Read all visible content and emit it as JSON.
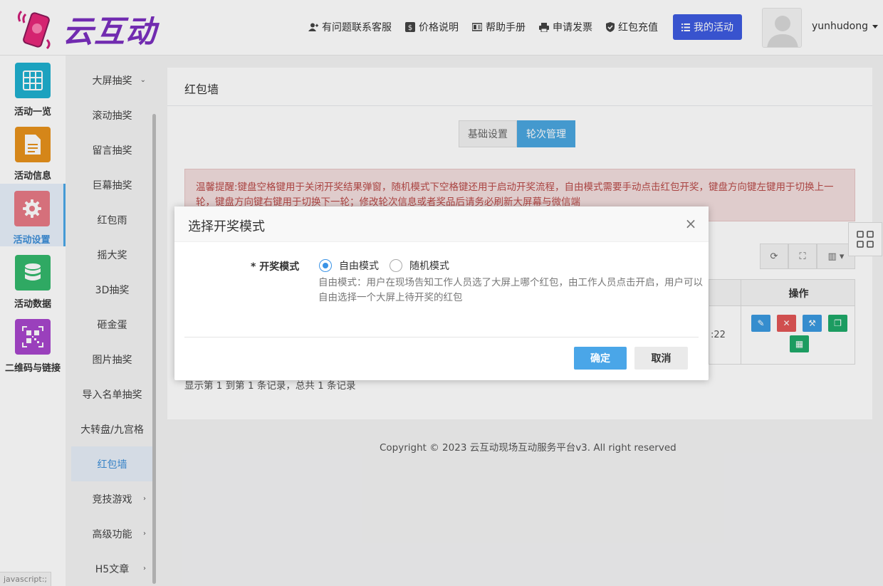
{
  "header": {
    "logo_text": "云互动",
    "nav": [
      {
        "label": "有问题联系客服",
        "icon": "user-plus-icon"
      },
      {
        "label": "价格说明",
        "icon": "dollar-icon"
      },
      {
        "label": "帮助手册",
        "icon": "book-icon"
      },
      {
        "label": "申请发票",
        "icon": "printer-icon"
      },
      {
        "label": "红包充值",
        "icon": "shield-check-icon"
      }
    ],
    "my_activity": "我的活动",
    "username": "yunhudong"
  },
  "sidebar1": {
    "items": [
      {
        "label": "活动一览",
        "icon": "grid-icon",
        "color": "#1fb0d0"
      },
      {
        "label": "活动信息",
        "icon": "document-icon",
        "color": "#e8921c"
      },
      {
        "label": "活动设置",
        "icon": "gear-icon",
        "color": "#e87a86"
      },
      {
        "label": "活动数据",
        "icon": "database-icon",
        "color": "#33b86c"
      },
      {
        "label": "二维码与链接",
        "icon": "qrcode-icon",
        "color": "#a846cc"
      }
    ]
  },
  "sidebar2": {
    "items": [
      {
        "label": "大屏抽奖",
        "chevron": "⌄"
      },
      {
        "label": "滚动抽奖"
      },
      {
        "label": "留言抽奖"
      },
      {
        "label": "巨幕抽奖"
      },
      {
        "label": "红包雨"
      },
      {
        "label": "摇大奖"
      },
      {
        "label": "3D抽奖"
      },
      {
        "label": "砸金蛋"
      },
      {
        "label": "图片抽奖"
      },
      {
        "label": "导入名单抽奖"
      },
      {
        "label": "大转盘/九宫格"
      },
      {
        "label": "红包墙"
      },
      {
        "label": "竞技游戏",
        "chevron": "›"
      },
      {
        "label": "高级功能",
        "chevron": "›"
      },
      {
        "label": "H5文章",
        "chevron": "›"
      }
    ]
  },
  "main": {
    "title": "红包墙",
    "tabs": [
      "基础设置",
      "轮次管理"
    ],
    "notice": "温馨提醒:键盘空格键用于关闭开奖结果弹窗，随机模式下空格键还用于启动开奖流程，自由模式需要手动点击红包开奖，键盘方向键左键用于切换上一轮，键盘方向键右键用于切换下一轮；修改轮次信息或者奖品后请务必刷新大屏幕与微信端",
    "table": {
      "header_ops": "操作",
      "row_time_fragment": ":22"
    },
    "summary": "显示第 1 到第 1 条记录，总共 1 条记录"
  },
  "copyright": "Copyright © 2023 云互动现场互动服务平台v3. All right reserved",
  "statusbar": "javascript:;",
  "modal": {
    "title": "选择开奖模式",
    "close": "×",
    "field_label": "开奖模式",
    "required_mark": "* ",
    "options": [
      "自由模式",
      "随机模式"
    ],
    "description": "自由模式：用户在现场告知工作人员选了大屏上哪个红包，由工作人员点击开启，用户可以自由选择一个大屏上待开奖的红包",
    "ok": "确定",
    "cancel": "取消"
  }
}
